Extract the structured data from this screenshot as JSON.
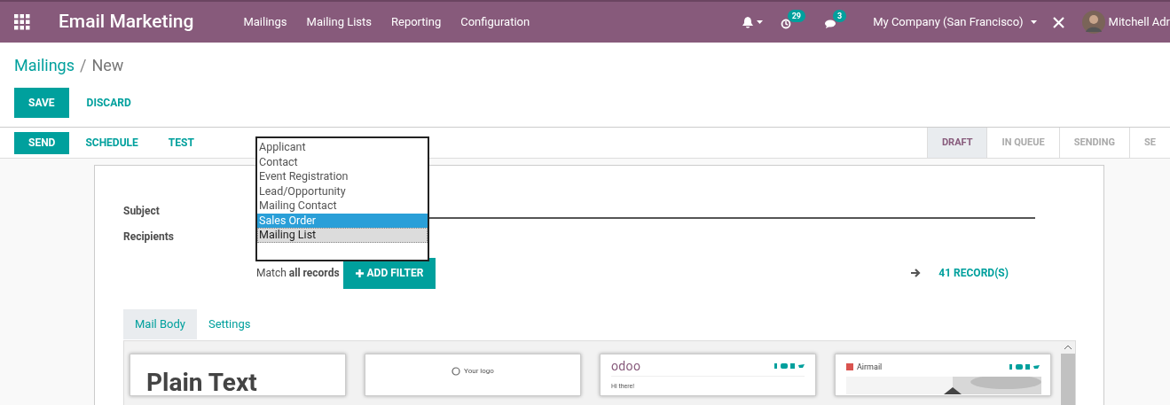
{
  "navbar": {
    "app_title": "Email Marketing",
    "menu": [
      "Mailings",
      "Mailing Lists",
      "Reporting",
      "Configuration"
    ],
    "activity_count": "29",
    "message_count": "3",
    "company": "My Company (San Francisco)",
    "user": "Mitchell Adr"
  },
  "breadcrumb": {
    "parent": "Mailings",
    "separator": "/",
    "current": "New"
  },
  "form_buttons": {
    "save": "SAVE",
    "discard": "DISCARD"
  },
  "actions": [
    {
      "label": "SEND",
      "primary": true
    },
    {
      "label": "SCHEDULE",
      "primary": false
    },
    {
      "label": "TEST",
      "primary": false
    }
  ],
  "stages": [
    {
      "label": "DRAFT",
      "selected": true
    },
    {
      "label": "IN QUEUE",
      "selected": false
    },
    {
      "label": "SENDING",
      "selected": false
    },
    {
      "label": "SE",
      "selected": false
    }
  ],
  "fields": {
    "subject_label": "Subject",
    "recipients_label": "Recipients"
  },
  "recipients_dropdown": [
    {
      "label": "Applicant",
      "highlighted": false,
      "selected": false
    },
    {
      "label": "Contact",
      "highlighted": false,
      "selected": false
    },
    {
      "label": "Event Registration",
      "highlighted": false,
      "selected": false
    },
    {
      "label": "Lead/Opportunity",
      "highlighted": false,
      "selected": false
    },
    {
      "label": "Mailing Contact",
      "highlighted": false,
      "selected": false
    },
    {
      "label": "Sales Order",
      "highlighted": true,
      "selected": false
    },
    {
      "label": "Mailing List",
      "highlighted": false,
      "selected": true
    }
  ],
  "filter": {
    "match_text": "Match **all records**",
    "add_filter": "ADD FILTER",
    "record_count": "41 RECORD(S)"
  },
  "tabs": [
    {
      "label": "Mail Body",
      "selected": true
    },
    {
      "label": "Settings",
      "selected": false
    }
  ],
  "templates": [
    {
      "kind": "plain",
      "title": "Plain Text"
    },
    {
      "kind": "logo",
      "title": "Your logo"
    },
    {
      "kind": "odoo",
      "title": "odoo",
      "greeting": "Hi there!"
    },
    {
      "kind": "airmail",
      "title": "Airmail"
    }
  ]
}
